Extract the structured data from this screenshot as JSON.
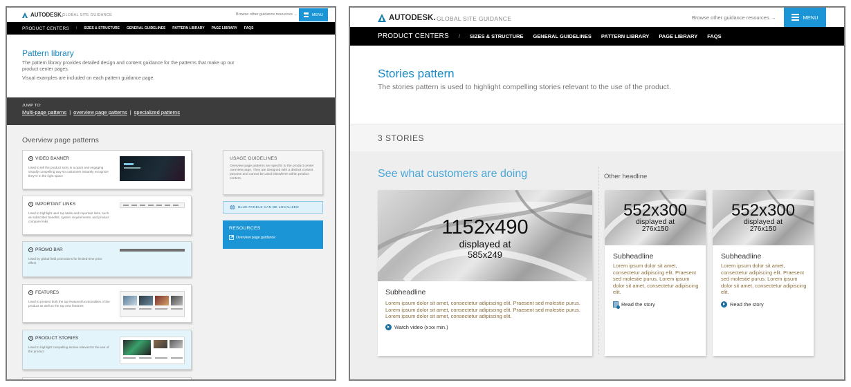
{
  "left": {
    "header": {
      "brand": "AUTODESK.",
      "site_name": "GLOBAL SITE GUIDANCE",
      "browse_link": "Browse other guidance resources",
      "browse_arrow": "→",
      "menu_label": "MENU"
    },
    "nav": {
      "product_centers": "PRODUCT CENTERS",
      "separator": "/",
      "items": [
        "SIZES & STRUCTURE",
        "GENERAL GUIDELINES",
        "PATTERN LIBRARY",
        "PAGE LIBRARY",
        "FAQS"
      ]
    },
    "page_title": "Pattern library",
    "page_description": "The pattern library provides detailed design and content guidance for the patterns that make up our product center pages.",
    "page_note": "Visual examples are included on each pattern guidance page.",
    "jump": {
      "label": "JUMP TO:",
      "links": [
        "Multi-page patterns",
        "overview page patterns",
        "specialized patterns"
      ],
      "divider": "|"
    },
    "section_title": "Overview page patterns",
    "cards": [
      {
        "title": "VIDEO BANNER",
        "desc": "Used to tell the product story in a quick and engaging visually compelling way so customers instantly recognize they're in the right space"
      },
      {
        "title": "IMPORTANT LINKS",
        "desc": "Used to highlight user top tasks and important links, such as subscriber benefits, system requirements, and product compare links"
      },
      {
        "title": "PROMO BAR",
        "desc": "Used by global field promotions for limited-time price offers"
      },
      {
        "title": "FEATURES",
        "desc": "Used to present both the top features/functionalities of the product as well as the top new features"
      },
      {
        "title": "PRODUCT STORIES",
        "desc": "Used to highlight compelling stories relevant to the use of the product"
      }
    ],
    "usage": {
      "title": "USAGE GUIDELINES",
      "desc": "Overview page patterns are specific to the product center overview page. They are designed with a distinct content purpose and cannot be used elsewhere within product centers."
    },
    "blue_panel": "BLUE PANELS CAN BE LOCALIZED",
    "resources": {
      "title": "RESOURCES",
      "link": "Overview page guidance"
    }
  },
  "right": {
    "header": {
      "brand": "AUTODESK.",
      "site_name": "GLOBAL SITE GUIDANCE",
      "browse_link": "Browse other guidance resources",
      "browse_arrow": "→",
      "menu_label": "MENU"
    },
    "nav": {
      "product_centers": "PRODUCT CENTERS",
      "separator": "/",
      "items": [
        "SIZES & STRUCTURE",
        "GENERAL GUIDELINES",
        "PATTERN LIBRARY",
        "PAGE LIBRARY",
        "FAQS"
      ]
    },
    "page_title": "Stories pattern",
    "page_description": "The stories pattern is used to highlight compelling stories relevant to the use of the product.",
    "count_label": "3 STORIES",
    "main_heading": "See what customers are doing",
    "other_heading": "Other headline",
    "featured": {
      "image_size": "1152x490",
      "displayed_label": "displayed at",
      "displayed_size": "585x249",
      "subheadline": "Subheadline",
      "body": "Lorem ipsum dolor sit amet, consectetur adipiscing elit. Praesent sed molestie purus. Lorem ipsum dolor sit amet, consectetur adipiscing elit. Praesent sed molestie purus. Lorem ipsum dolor sit amet, consectetur adipiscing elit.",
      "link": "Watch video (x:xx min.)"
    },
    "side_cards": [
      {
        "image_size": "552x300",
        "displayed_label": "displayed at",
        "displayed_size": "276x150",
        "subheadline": "Subheadline",
        "body": "Lorem ipsum dolor sit amet, consectetur adipiscing elit. Praesent sed molestie purus. Lorem ipsum dolor sit amet, consectetur adipiscing elit.",
        "link": "Read the story"
      },
      {
        "image_size": "552x300",
        "displayed_label": "displayed at",
        "displayed_size": "276x150",
        "subheadline": "Subheadline",
        "body": "Lorem ipsum dolor sit amet, consectetur adipiscing elit. Praesent sed molestie purus. Lorem ipsum dolor sit amet, consectetur adipiscing elit.",
        "link": "Read the story"
      }
    ]
  }
}
